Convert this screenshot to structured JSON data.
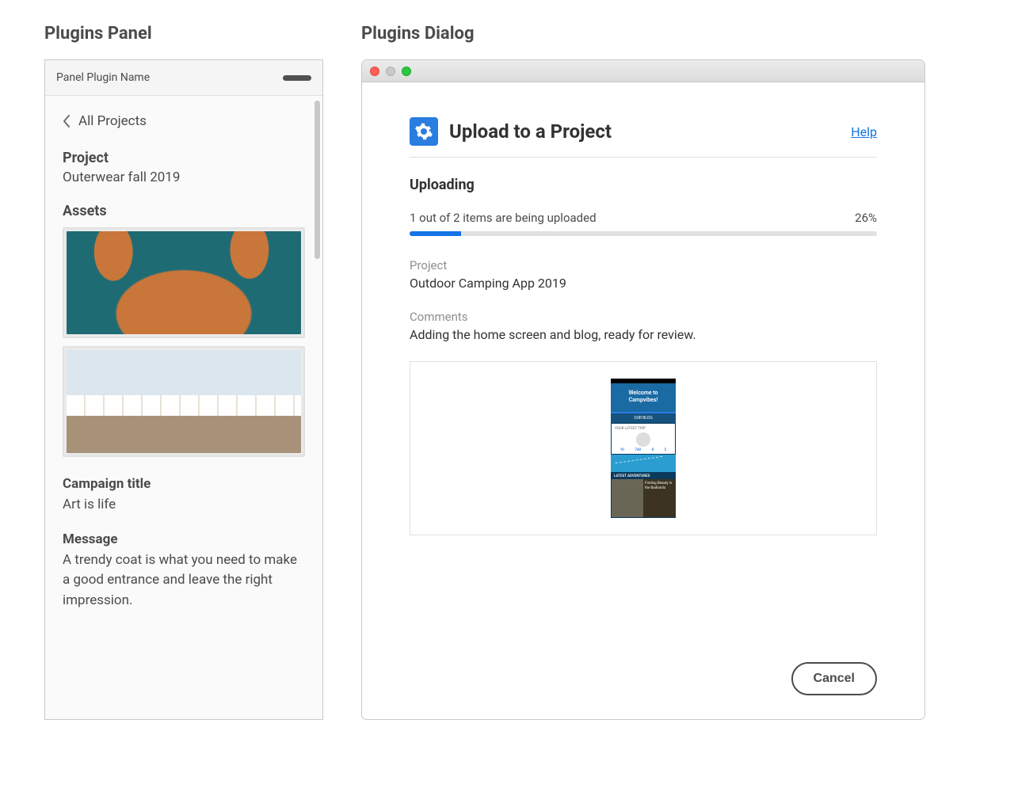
{
  "panel": {
    "title": "Plugins Panel",
    "header_label": "Panel Plugin Name",
    "back_label": "All Projects",
    "project_label": "Project",
    "project_name": "Outerwear fall 2019",
    "assets_label": "Assets",
    "campaign_label": "Campaign title",
    "campaign_value": "Art is life",
    "message_label": "Message",
    "message_value": "A trendy coat is what you need to make a good entrance and leave the right impression."
  },
  "dialog": {
    "title": "Plugins Dialog",
    "heading": "Upload to a Project",
    "help_label": "Help",
    "uploading_label": "Uploading",
    "progress_status": "1 out of 2 items are being uploaded",
    "progress_percent_label": "26%",
    "progress_percent": 26,
    "project_field_label": "Project",
    "project_field_value": "Outdoor Camping App 2019",
    "comments_field_label": "Comments",
    "comments_field_value": "Adding the home screen and blog, ready for review.",
    "preview": {
      "welcome": "Welcome to Campvibes!",
      "blog_button": "OUR BLOG",
      "card_title": "YOUR LATEST TRIP",
      "adventures_label": "LATEST ADVENTURES"
    },
    "cancel_label": "Cancel"
  }
}
